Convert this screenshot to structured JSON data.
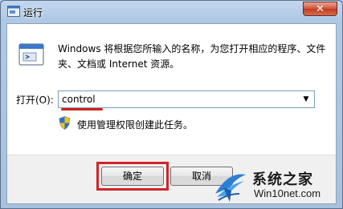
{
  "window": {
    "title": "运行",
    "close_label": "✕"
  },
  "dialog": {
    "description": "Windows 将根据您所输入的名称，为您打开相应的程序、文件夹、文档或 Internet 资源。",
    "open_label": "打开(O):",
    "command_value": "control",
    "admin_note": "使用管理权限创建此任务。"
  },
  "buttons": {
    "ok_label": "确定",
    "cancel_label": "取消"
  },
  "watermark": {
    "title": "系统之家",
    "url": "Win10net.com"
  },
  "colors": {
    "highlight": "#d2232a",
    "underline": "#d0221c"
  }
}
